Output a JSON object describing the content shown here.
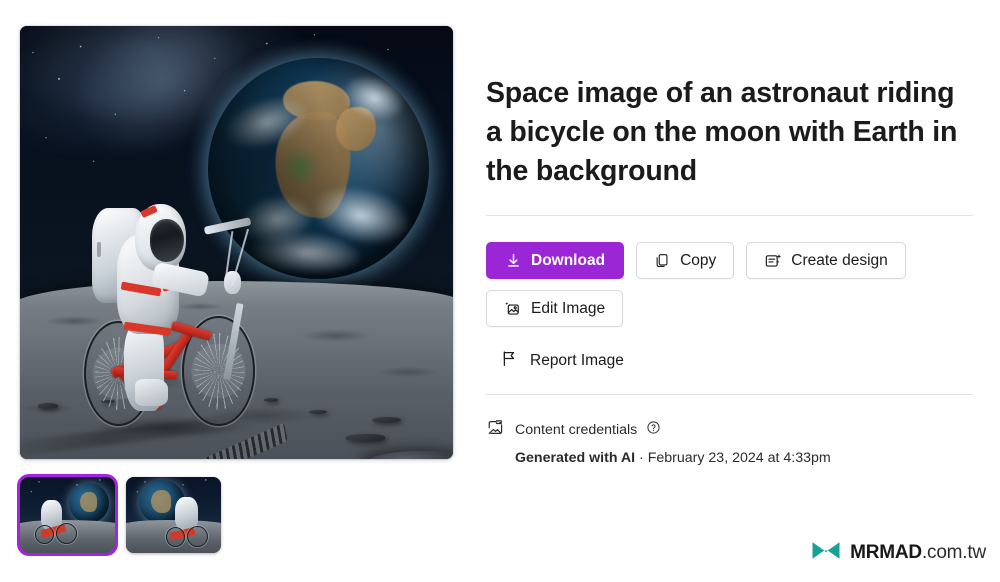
{
  "image": {
    "alt_description": "AI generated space image of an astronaut riding a red bicycle on the lunar surface with Earth rising in the background",
    "thumbnails": [
      {
        "name": "thumbnail-1",
        "selected": true,
        "alt": "astronaut on bicycle facing right with Earth at upper right"
      },
      {
        "name": "thumbnail-2",
        "selected": false,
        "alt": "astronaut on bicycle facing left with Earth at upper left"
      }
    ]
  },
  "detail": {
    "title": "Space image of an astronaut riding a bicycle on the moon with Earth in the background",
    "actions": [
      {
        "id": "download",
        "label": "Download",
        "icon": "download-icon",
        "style": "primary"
      },
      {
        "id": "copy",
        "label": "Copy",
        "icon": "copy-icon",
        "style": "secondary"
      },
      {
        "id": "create-design",
        "label": "Create design",
        "icon": "create-design-icon",
        "style": "secondary"
      },
      {
        "id": "edit-image",
        "label": "Edit Image",
        "icon": "edit-image-icon",
        "style": "secondary"
      }
    ],
    "report": {
      "label": "Report Image",
      "icon": "flag-icon"
    },
    "credentials": {
      "icon": "content-credentials-icon",
      "label": "Content credentials",
      "help_icon": "help-circle-icon",
      "generated_label": "Generated with AI",
      "separator": " · ",
      "timestamp": "February 23, 2024 at 4:33pm"
    }
  },
  "watermark": {
    "logo_icon": "mrmad-logo-icon",
    "brand": "MRMAD",
    "tld": ".com.tw"
  },
  "colors": {
    "primary": "#9b26d6",
    "selection": "#a820e4",
    "divider": "#e3e3e3",
    "text": "#1b1b1b",
    "watermark_logo": "#16a395"
  }
}
